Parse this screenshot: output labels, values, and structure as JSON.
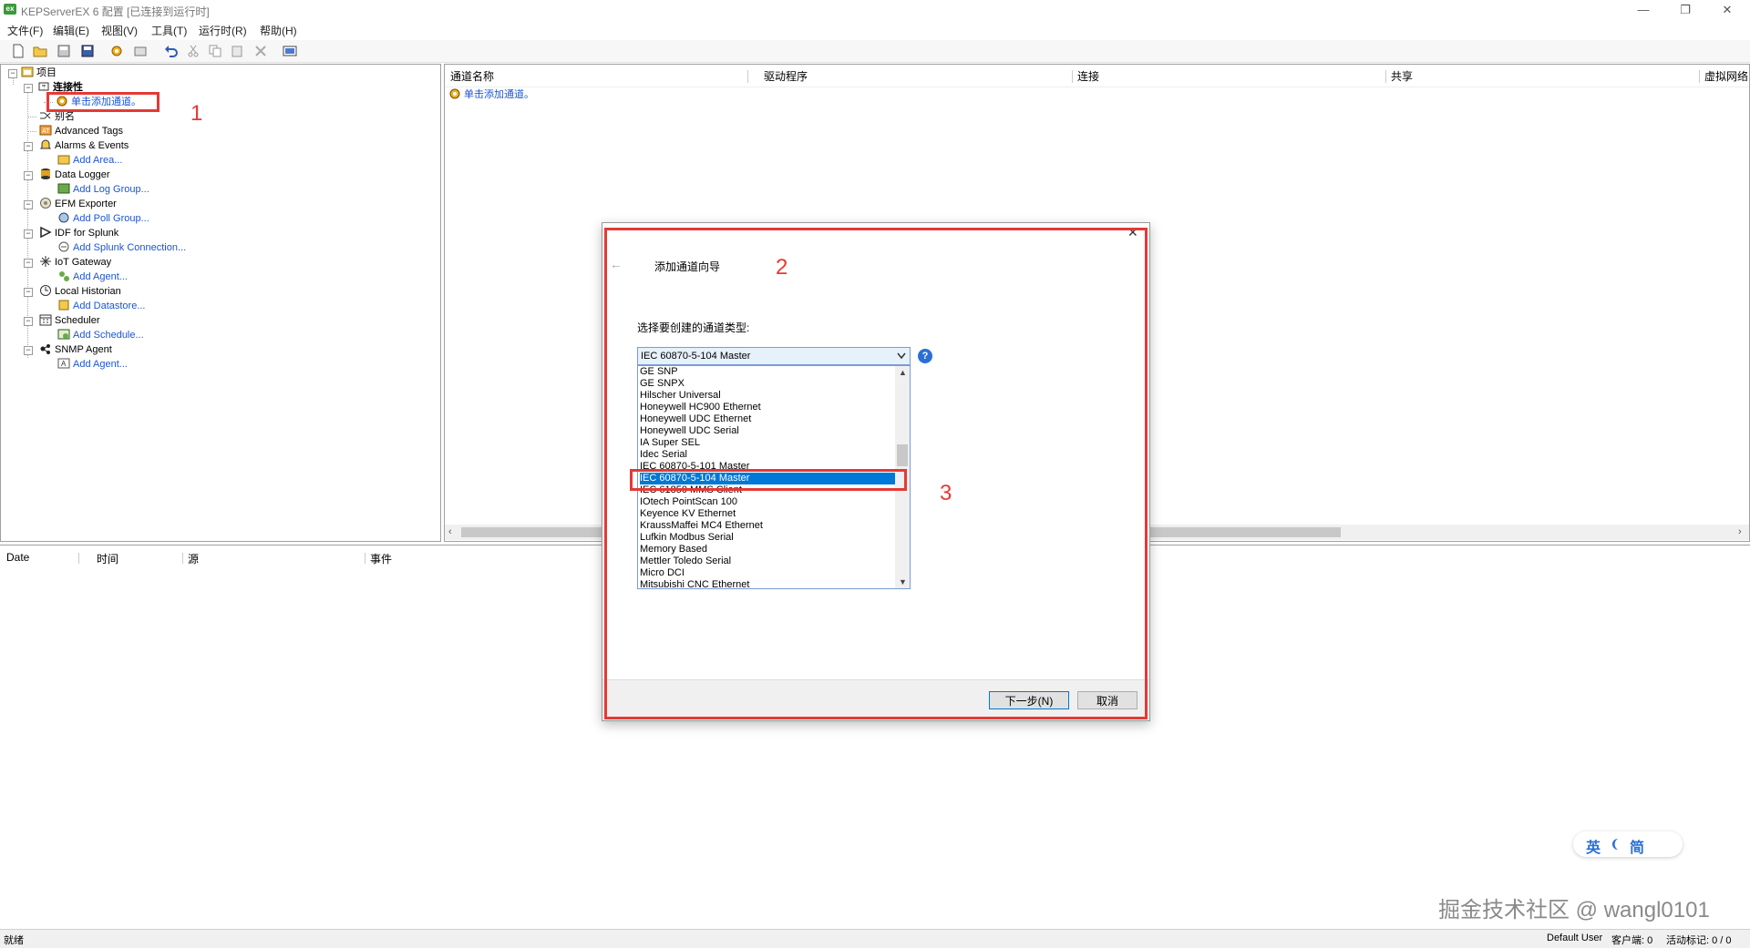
{
  "window": {
    "title": "KEPServerEX 6 配置 [已连接到运行时]",
    "app_icon_text": "ex",
    "minimize": "—",
    "restore": "❐",
    "close": "✕"
  },
  "menu": [
    "文件(F)",
    "编辑(E)",
    "视图(V)",
    "工具(T)",
    "运行时(R)",
    "帮助(H)"
  ],
  "tree": {
    "root": "项目",
    "connectivity": "连接性",
    "add_channel": "单击添加通道。",
    "aliases": "别名",
    "items": [
      {
        "label": "Advanced Tags",
        "child": ""
      },
      {
        "label": "Alarms & Events",
        "child": "Add Area..."
      },
      {
        "label": "Data Logger",
        "child": "Add Log Group..."
      },
      {
        "label": "EFM Exporter",
        "child": "Add Poll Group..."
      },
      {
        "label": "IDF for Splunk",
        "child": "Add Splunk Connection..."
      },
      {
        "label": "IoT Gateway",
        "child": "Add Agent..."
      },
      {
        "label": "Local Historian",
        "child": "Add Datastore..."
      },
      {
        "label": "Scheduler",
        "child": "Add Schedule..."
      },
      {
        "label": "SNMP Agent",
        "child": "Add Agent..."
      }
    ]
  },
  "channel_list": {
    "columns": [
      "通道名称",
      "驱动程序",
      "连接",
      "共享",
      "虚拟网络"
    ],
    "add_channel": "单击添加通道。"
  },
  "events": {
    "columns": [
      "Date",
      "时间",
      "源",
      "事件"
    ]
  },
  "dialog": {
    "title": "添加通道向导",
    "close": "✕",
    "back": "←",
    "prompt": "选择要创建的通道类型:",
    "selected": "IEC 60870-5-104 Master",
    "help": "?",
    "options": [
      "GE SNP",
      "GE SNPX",
      "Hilscher Universal",
      "Honeywell HC900 Ethernet",
      "Honeywell UDC Ethernet",
      "Honeywell UDC Serial",
      "IA Super SEL",
      "Idec Serial",
      "IEC 60870-5-101 Master",
      "IEC 60870-5-104 Master",
      "IEC 61850 MMS Client",
      "IOtech PointScan 100",
      "Keyence KV Ethernet",
      "KraussMaffei MC4 Ethernet",
      "Lufkin Modbus Serial",
      "Memory Based",
      "Mettler Toledo Serial",
      "Micro DCI",
      "Mitsubishi CNC Ethernet"
    ],
    "next_button": "下一步(N)",
    "cancel_button": "取消"
  },
  "annotations": {
    "one": "1",
    "two": "2",
    "three": "3"
  },
  "ime": {
    "lang": "英",
    "mode": "简"
  },
  "watermark": "掘金技术社区 @ wangl0101",
  "status": {
    "ready": "就绪",
    "user": "Default User",
    "clients": "客户端: 0",
    "active_tags": "活动标记: 0 / 0"
  },
  "colors": {
    "accent": "#0078d7",
    "annotation": "#e53935",
    "link": "#1a55d6"
  }
}
